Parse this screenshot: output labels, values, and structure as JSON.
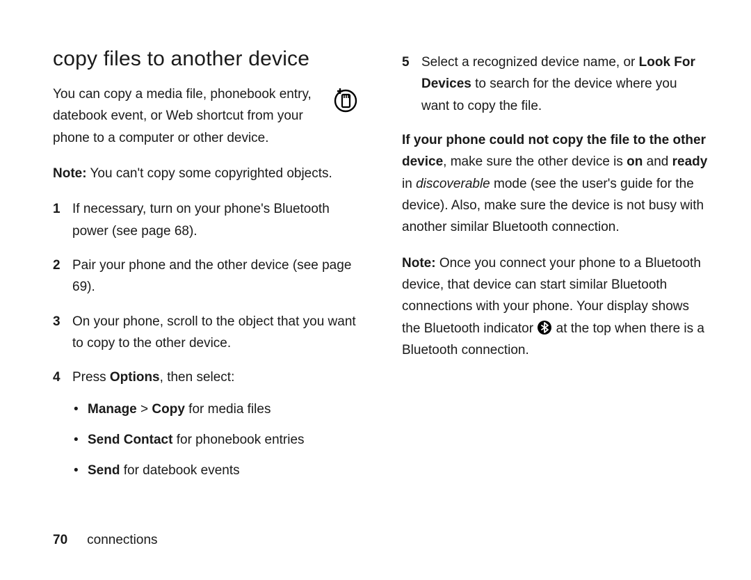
{
  "left": {
    "title": "copy files to another device",
    "intro": "You can copy a media file, phonebook entry, datebook event, or Web shortcut from your phone to a computer or other device.",
    "note_label": "Note:",
    "note_text": " You can't copy some copyrighted objects.",
    "steps": [
      {
        "num": "1",
        "text": "If necessary, turn on your phone's Bluetooth power (see page 68)."
      },
      {
        "num": "2",
        "text": "Pair your phone and the other device (see page 69)."
      },
      {
        "num": "3",
        "text": "On your phone, scroll to the object that you want to copy to the other device."
      },
      {
        "num": "4",
        "prefix": "Press ",
        "options_word": "Options",
        "suffix": ", then select:"
      }
    ],
    "bullets": [
      {
        "bold1": "Manage",
        "mid": " > ",
        "bold2": "Copy",
        "rest": " for media files"
      },
      {
        "bold1": "Send Contact",
        "rest": " for phonebook entries"
      },
      {
        "bold1": "Send",
        "rest": " for datebook events"
      }
    ]
  },
  "right": {
    "step5": {
      "num": "5",
      "text_a": "Select a recognized device name, or ",
      "look": "Look For Devices",
      "text_b": " to search for the device where you want to copy the file."
    },
    "trouble_bold1": "If your phone could not copy the file to the other device",
    "trouble_a": ", make sure the other device is ",
    "trouble_on": "on",
    "trouble_and": " and ",
    "trouble_ready": "ready",
    "trouble_b": " in ",
    "trouble_disc": "discoverable",
    "trouble_c": " mode (see the user's guide for the device). Also, make sure the device is not busy with another similar Bluetooth connection.",
    "note2_label": "Note:",
    "note2_a": " Once you connect your phone to a Bluetooth device, that device can start similar Bluetooth connections with your phone. Your display shows the Bluetooth indicator ",
    "note2_b": " at the top when there is a Bluetooth connection."
  },
  "footer": {
    "page": "70",
    "section": "connections"
  }
}
